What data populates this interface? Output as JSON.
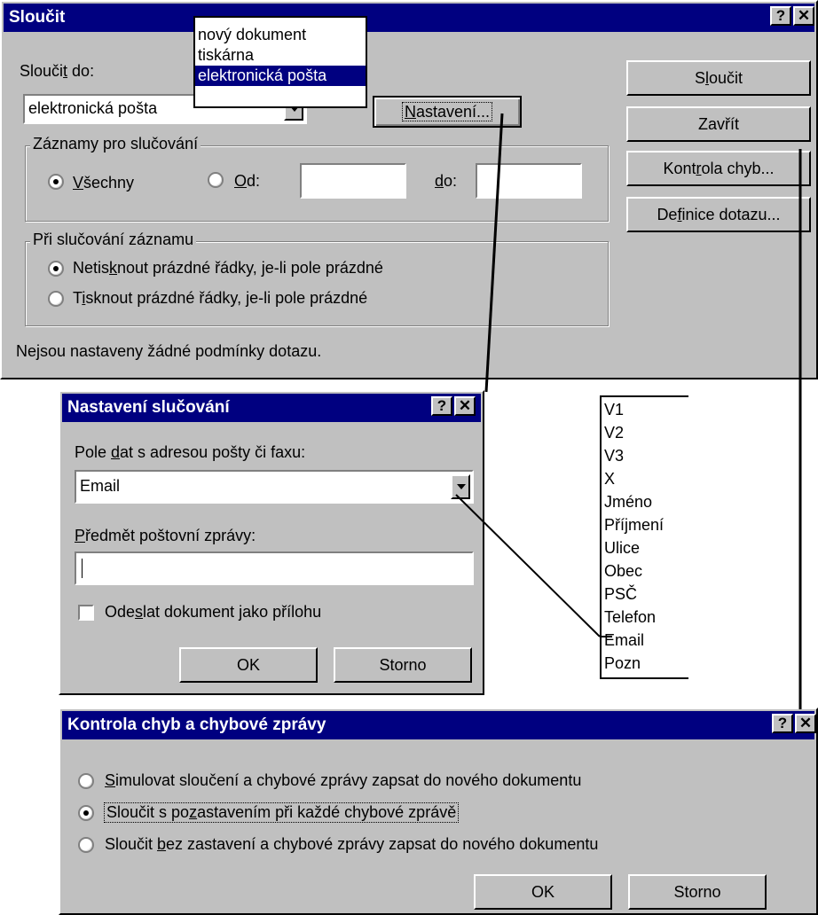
{
  "merge_dialog": {
    "title": "Sloučit",
    "merge_to_label": "Sloučit do:",
    "merge_to_value": "elektronická pošta",
    "merge_to_options": [
      "nový dokument",
      "tiskárna",
      "elektronická pošta"
    ],
    "setup_button": "Nastavení...",
    "records_group": "Záznamy pro slučování",
    "all_label": "Všechny",
    "from_label": "Od:",
    "to_label": "do:",
    "from_value": "",
    "to_value": "",
    "blank_group": "Při slučování záznamu",
    "no_print_blank": "Netisknout prázdné řádky, je-li pole prázdné",
    "print_blank": "Tisknout prázdné řádky, je-li pole prázdné",
    "status": "Nejsou nastaveny žádné podmínky dotazu.",
    "merge_button": "Sloučit",
    "close_button": "Zavřít",
    "check_errors_button": "Kontrola chyb...",
    "query_options_button": "Definice dotazu..."
  },
  "setup_dialog": {
    "title": "Nastavení slučování",
    "address_field_label": "Pole dat s adresou pošty či faxu:",
    "address_field_value": "Email",
    "subject_label": "Předmět poštovní zprávy:",
    "subject_value": "",
    "attachment_label": "Odeslat dokument jako přílohu",
    "ok": "OK",
    "cancel": "Storno"
  },
  "field_list": [
    "V1",
    "V2",
    "V3",
    "X",
    "Jméno",
    "Příjmení",
    "Ulice",
    "Obec",
    "PSČ",
    "Telefon",
    "Email",
    "Pozn"
  ],
  "check_dialog": {
    "title": "Kontrola chyb a chybové zprávy",
    "option1": "Simulovat sloučení a chybové zprávy zapsat do nového dokumentu",
    "option2": "Sloučit s pozastavením při každé chybové zprávě",
    "option3": "Sloučit bez zastavení a chybové zprávy zapsat do nového dokumentu",
    "ok": "OK",
    "cancel": "Storno"
  },
  "title_buttons": {
    "help": "?",
    "close": "✕"
  }
}
